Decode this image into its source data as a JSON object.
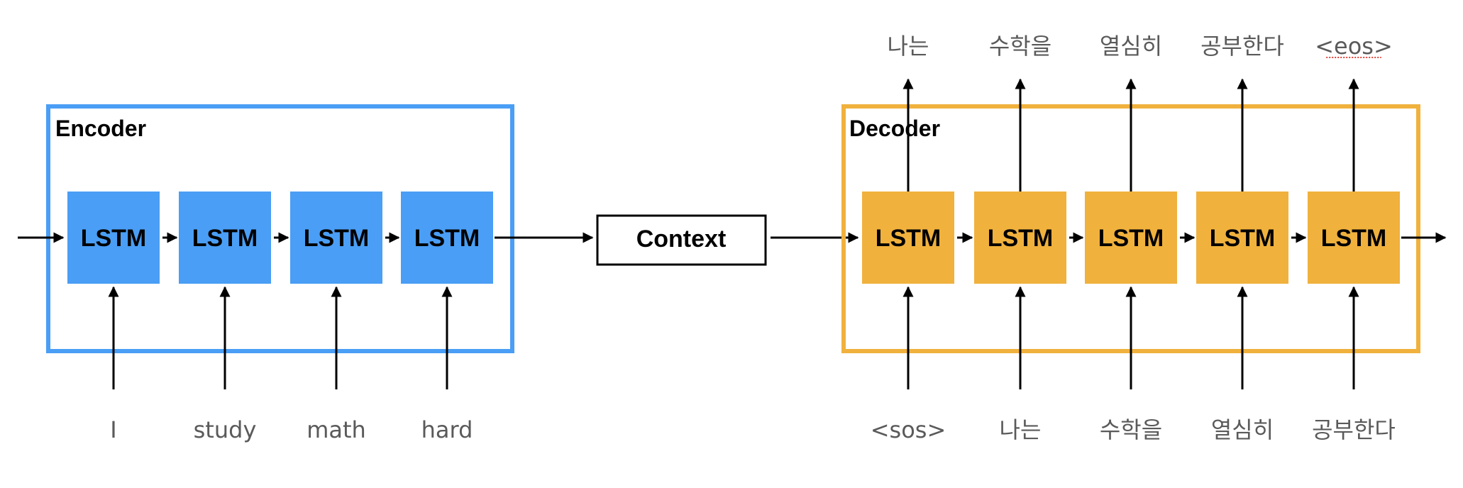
{
  "colors": {
    "encoder": "#4A9EF5",
    "decoder": "#F0B13D",
    "arrow": "#000000",
    "token_text": "#5A5A5A",
    "context_border": "#000000",
    "spellcheck_underline": "#E0443C"
  },
  "encoder": {
    "label": "Encoder",
    "cells": [
      {
        "label": "LSTM",
        "input": "I"
      },
      {
        "label": "LSTM",
        "input": "study"
      },
      {
        "label": "LSTM",
        "input": "math"
      },
      {
        "label": "LSTM",
        "input": "hard"
      }
    ]
  },
  "context": {
    "label": "Context"
  },
  "decoder": {
    "label": "Decoder",
    "cells": [
      {
        "label": "LSTM",
        "input": "<sos>",
        "output": "나는"
      },
      {
        "label": "LSTM",
        "input": "나는",
        "output": "수학을"
      },
      {
        "label": "LSTM",
        "input": "수학을",
        "output": "열심히"
      },
      {
        "label": "LSTM",
        "input": "열심히",
        "output": "공부한다"
      },
      {
        "label": "LSTM",
        "input": "공부한다",
        "output": "<eos>"
      }
    ]
  }
}
